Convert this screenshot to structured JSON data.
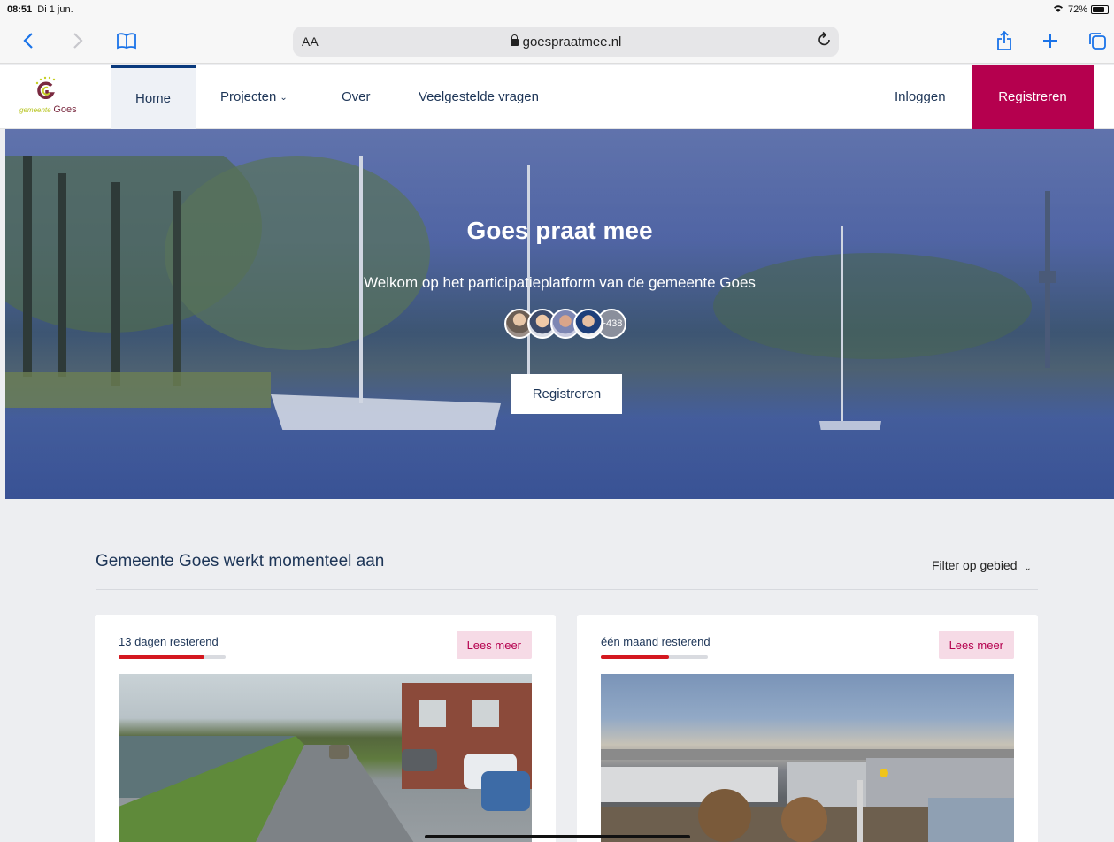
{
  "status": {
    "time": "08:51",
    "date": "Di 1 jun.",
    "battery": "72%"
  },
  "browser": {
    "aa_label": "AA",
    "url": "goespraatmee.nl"
  },
  "logo": {
    "small": "gemeente",
    "name": "Goes"
  },
  "nav": {
    "home": "Home",
    "projecten": "Projecten",
    "over": "Over",
    "faq": "Veelgestelde vragen",
    "login": "Inloggen",
    "register": "Registreren"
  },
  "hero": {
    "title": "Goes praat mee",
    "subtitle": "Welkom op het participatieplatform van de gemeente Goes",
    "avatar_count": "+438",
    "button": "Registreren"
  },
  "section": {
    "title": "Gemeente Goes werkt momenteel aan",
    "filter": "Filter op gebied"
  },
  "cards": [
    {
      "remaining": "13 dagen resterend",
      "progress": 0.8,
      "button": "Lees meer"
    },
    {
      "remaining": "één maand resterend",
      "progress": 0.64,
      "button": "Lees meer"
    }
  ],
  "colors": {
    "brand": "#b5004e",
    "navy": "#1d3557",
    "progress": "#d4181f"
  }
}
